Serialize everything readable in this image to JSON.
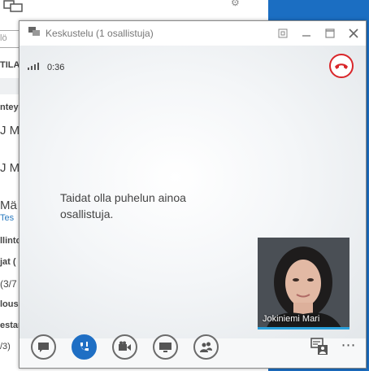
{
  "background": {
    "search_fragment": "lö",
    "tab_fragment": "TILA",
    "list_fragments": [
      {
        "text": "nteys",
        "bold": true
      },
      {
        "text": "J M",
        "bold": false
      },
      {
        "text": "J M",
        "bold": false
      },
      {
        "text": "Mä",
        "bold": false
      },
      {
        "text": "Tes",
        "bold": false
      },
      {
        "text": "llinto",
        "bold": true
      },
      {
        "text": "jat (",
        "bold": true
      },
      {
        "text": "(3/7",
        "bold": false
      },
      {
        "text": "lous",
        "bold": true
      },
      {
        "text": "estar",
        "bold": true
      },
      {
        "text": "/3)",
        "bold": false
      }
    ]
  },
  "window": {
    "title": "Keskustelu (1 osallistuja)",
    "controls": [
      "compact-icon",
      "minimize-icon",
      "maximize-icon",
      "close-icon"
    ]
  },
  "call": {
    "duration": "0:36",
    "status_message": "Taidat olla puhelun ainoa osallistuja.",
    "participant_name": "Jokiniemi Mari"
  },
  "toolbar": {
    "buttons": [
      "im-icon",
      "microphone-icon",
      "video-icon",
      "present-icon",
      "participants-icon"
    ],
    "more": "⋯"
  },
  "colors": {
    "hangup": "#d9262a",
    "mic_active": "#1f6fc4",
    "video_underline": "#2aa0db"
  }
}
